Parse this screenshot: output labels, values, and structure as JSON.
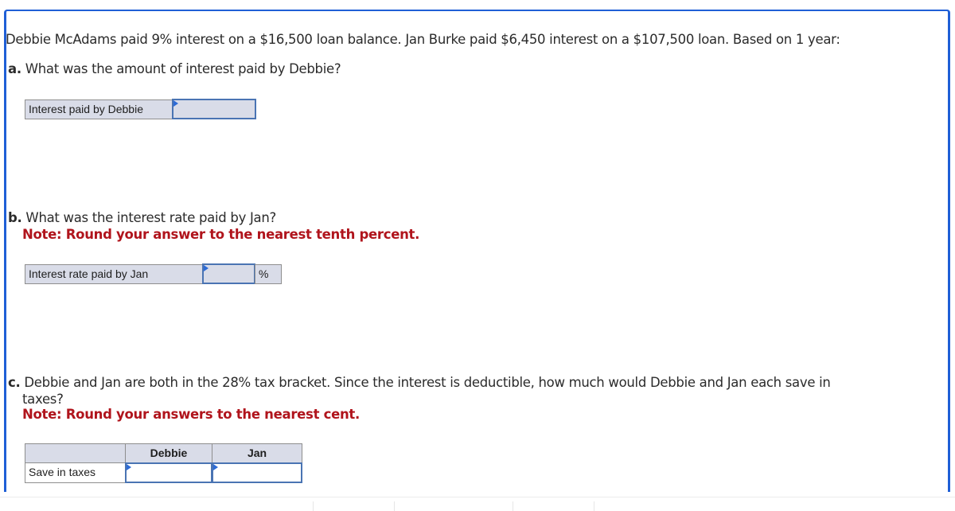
{
  "problem": {
    "intro": "Debbie McAdams paid 9% interest on a $16,500 loan balance. Jan Burke paid $6,450 interest on a $107,500 loan. Based on 1 year:"
  },
  "part_a": {
    "letter": "a.",
    "question": " What was the amount of interest paid by Debbie?",
    "row_label": "Interest paid by Debbie",
    "input_value": ""
  },
  "part_b": {
    "letter": "b.",
    "question": " What was the interest rate paid by Jan?",
    "note": "Note: Round your answer to the nearest tenth percent.",
    "row_label": "Interest rate paid by Jan",
    "input_value": "",
    "unit": "%"
  },
  "part_c": {
    "letter": "c.",
    "question_line1": " Debbie and Jan are both in the 28% tax bracket. Since the interest is deductible, how much would Debbie and Jan each save in",
    "question_line2": "taxes?",
    "note": "Note: Round your answers to the nearest cent.",
    "columns": [
      "",
      "Debbie",
      "Jan"
    ],
    "row_label": "Save in taxes",
    "debbie_value": "",
    "jan_value": ""
  },
  "colors": {
    "panel_border": "#1f5fd6",
    "note_red": "#b0141c",
    "input_border": "#4a74b3",
    "cell_bg": "#d9dce8"
  }
}
